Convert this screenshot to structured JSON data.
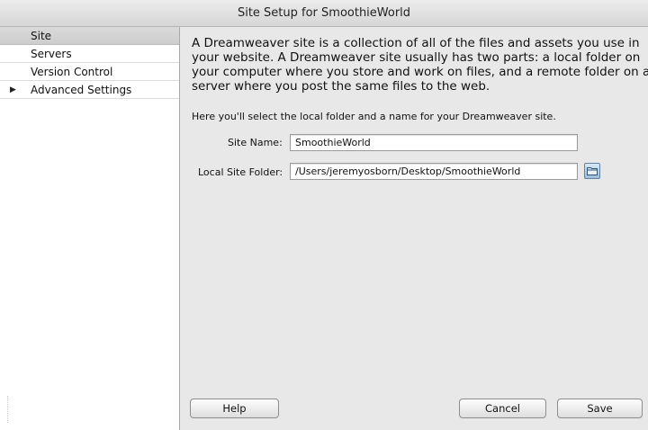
{
  "window": {
    "title": "Site Setup for SmoothieWorld"
  },
  "sidebar": {
    "items": [
      {
        "label": "Site",
        "selected": true
      },
      {
        "label": "Servers",
        "selected": false
      },
      {
        "label": "Version Control",
        "selected": false
      },
      {
        "label": "Advanced Settings",
        "selected": false,
        "expander": "right-triangle"
      }
    ]
  },
  "main": {
    "intro": "A Dreamweaver site is a collection of all of the files and assets you use in your website. A Dreamweaver site usually has two parts: a local folder on your computer where you store and work on files, and a remote folder on a server where you post the same files to the web.",
    "instructions": "Here you'll select the local folder and a name for your Dreamweaver site.",
    "site_name": {
      "label": "Site Name:",
      "value": "SmoothieWorld"
    },
    "local_folder": {
      "label": "Local Site Folder:",
      "value": "/Users/jeremyosborn/Desktop/SmoothieWorld",
      "browse_icon": "folder-icon"
    }
  },
  "buttons": {
    "help": "Help",
    "cancel": "Cancel",
    "save": "Save"
  },
  "colors": {
    "selected_row": "#d3d3d3",
    "panel_bg": "#e8e8e8",
    "folder_button": "#9cbcd8"
  }
}
